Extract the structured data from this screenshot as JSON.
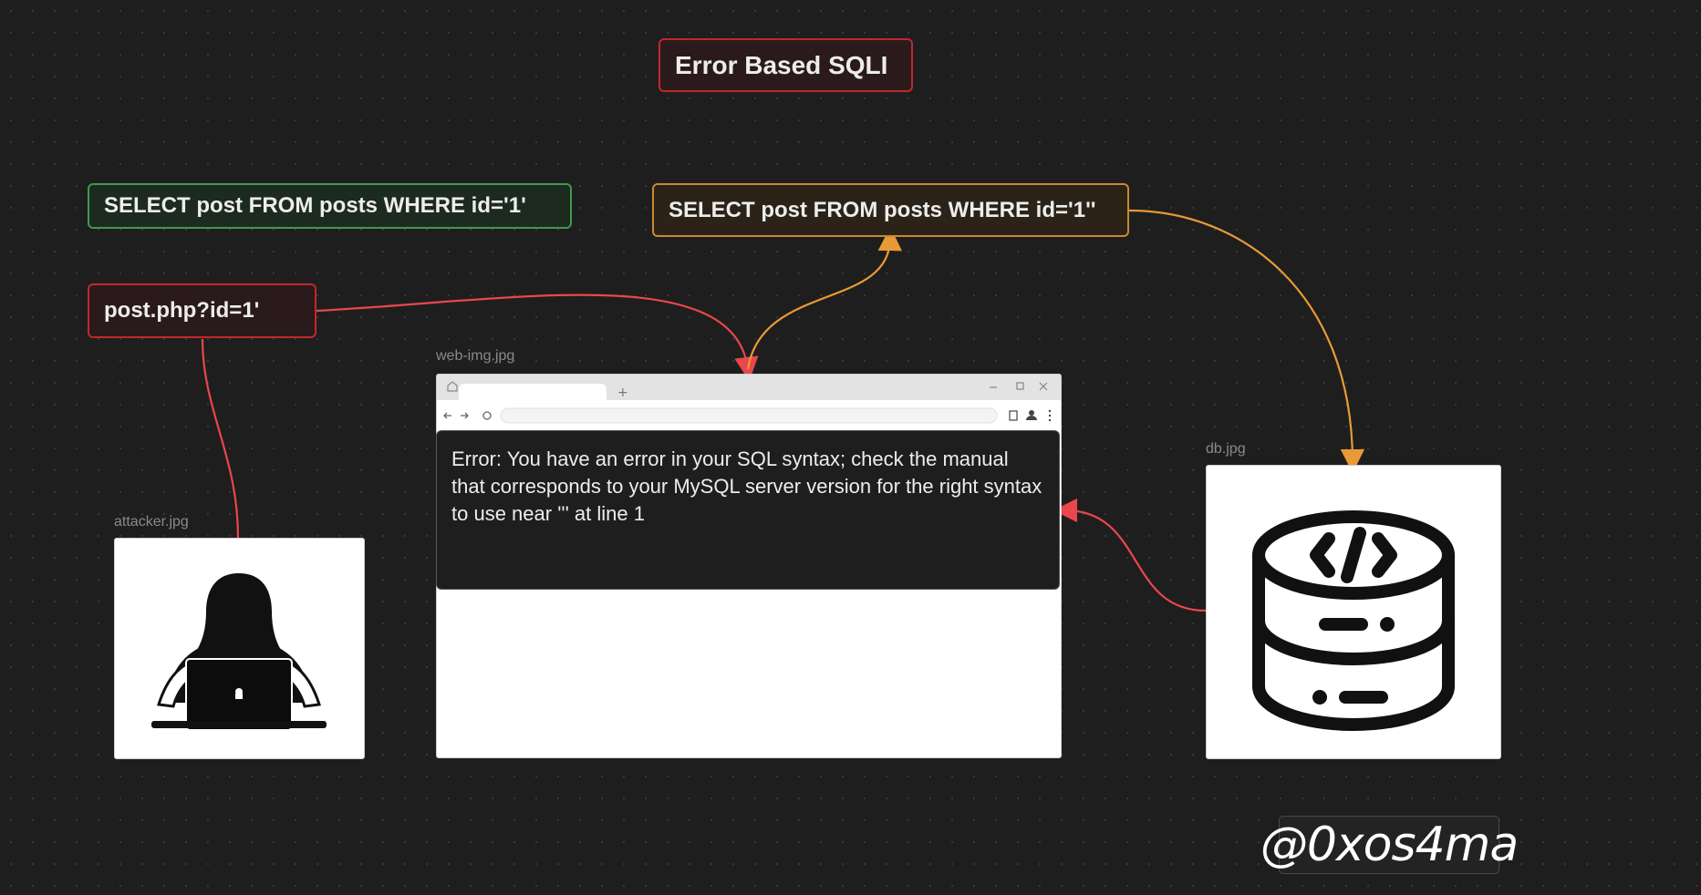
{
  "title": "Error Based SQLI",
  "nodes": {
    "original_query": "SELECT post FROM posts WHERE id='1'",
    "injected_query": "SELECT post FROM posts WHERE id='1''",
    "request_url": "post.php?id=1'"
  },
  "images": {
    "web": "web-img.jpg",
    "attacker": "attacker.jpg",
    "db": "db.jpg"
  },
  "error_message": "Error: You have an error in your SQL syntax; check the manual that corresponds to your MySQL server version for the right syntax to use near ''' at line 1",
  "signature": "@0xos4ma",
  "icons": [
    "hacker-icon",
    "database-code-icon",
    "browser-window-icon"
  ],
  "colors": {
    "red": "#c0282c",
    "green": "#3f9a4e",
    "orange": "#c98a2e",
    "edge_red": "#e8474b",
    "edge_orange": "#e89a36",
    "background": "#1e1e1e"
  }
}
